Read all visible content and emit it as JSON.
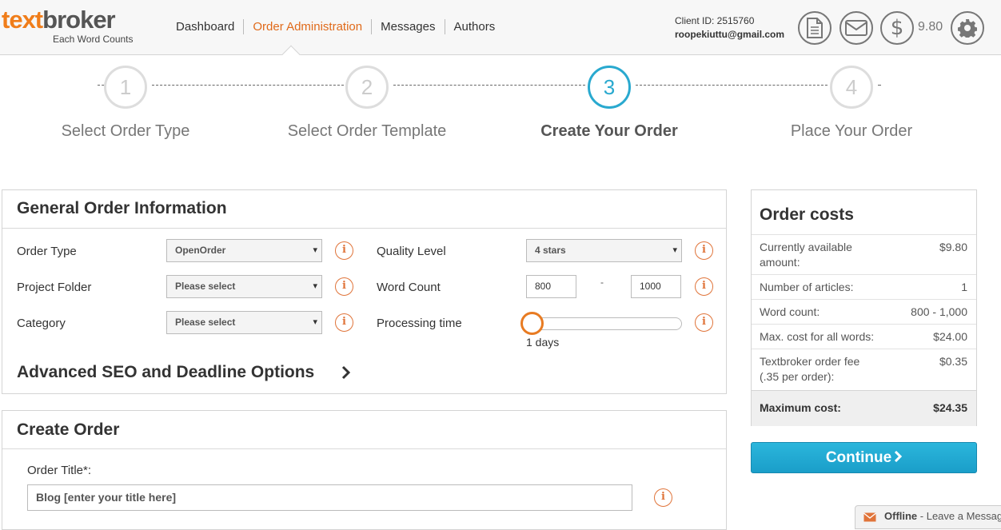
{
  "header": {
    "logo_text_1": "text",
    "logo_text_2": "broker",
    "logo_tagline": "Each Word Counts",
    "nav": [
      "Dashboard",
      "Order Administration",
      "Messages",
      "Authors"
    ],
    "client_id": "Client ID: 2515760",
    "email": "roopekiuttu@gmail.com",
    "balance": "9.80",
    "icons": [
      "document-icon",
      "envelope-icon",
      "dollar-icon",
      "gear-icon"
    ]
  },
  "steps": [
    {
      "num": "1",
      "label": "Select Order Type"
    },
    {
      "num": "2",
      "label": "Select Order Template"
    },
    {
      "num": "3",
      "label": "Create Your Order"
    },
    {
      "num": "4",
      "label": "Place Your Order"
    }
  ],
  "general": {
    "title": "General Order Information",
    "order_type_label": "Order Type",
    "order_type_value": "OpenOrder",
    "project_folder_label": "Project Folder",
    "project_folder_value": "Please select",
    "category_label": "Category",
    "category_value": "Please select",
    "quality_label": "Quality Level",
    "quality_value": "4 stars",
    "word_count_label": "Word Count",
    "word_min": "800",
    "word_dash": "-",
    "word_max": "1000",
    "processing_label": "Processing time",
    "processing_value": "1 days",
    "advanced_label": "Advanced SEO and Deadline Options",
    "info_glyph": "i"
  },
  "create": {
    "title": "Create Order",
    "order_title_label": "Order Title*:",
    "order_title_value": "Blog [enter your title here]"
  },
  "costs": {
    "title": "Order costs",
    "rows": [
      {
        "k": "Currently available amount:",
        "v": "$9.80"
      },
      {
        "k": "Number of articles:",
        "v": "1"
      },
      {
        "k": "Word count:",
        "v": "800 - 1,000"
      },
      {
        "k": "Max. cost for all words:",
        "v": "$24.00"
      },
      {
        "k": "Textbroker order fee (.35 per order):",
        "v": "$0.35"
      }
    ],
    "total_label": "Maximum cost:",
    "total_value": "$24.35",
    "continue_label": "Continue"
  },
  "chat": {
    "status": "Offline",
    "text": " - Leave a Message"
  },
  "colors": {
    "accent_orange": "#e06a1a",
    "accent_blue": "#29a9cf"
  }
}
